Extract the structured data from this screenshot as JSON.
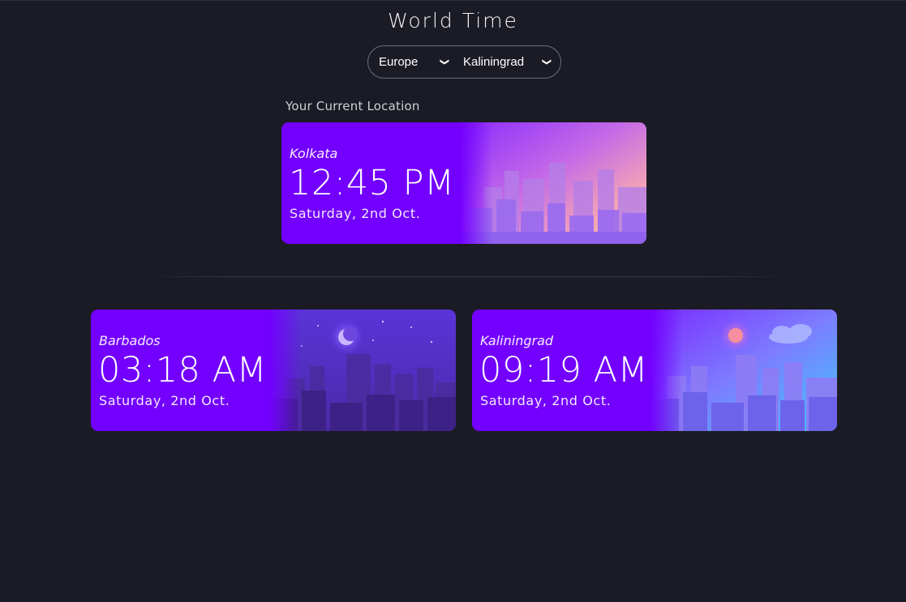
{
  "app": {
    "title": "World Time"
  },
  "selector": {
    "region": "Europe",
    "city": "Kaliningrad"
  },
  "current": {
    "label": "Your Current Location",
    "city": "Kolkata",
    "time": "12:45 PM",
    "date": "Saturday, 2nd Oct."
  },
  "clocks": [
    {
      "city": "Barbados",
      "time": "03:18 AM",
      "date": "Saturday, 2nd Oct."
    },
    {
      "city": "Kaliningrad",
      "time": "09:19 AM",
      "date": "Saturday, 2nd Oct."
    }
  ],
  "colors": {
    "background": "#1b1b25",
    "card": "#7300ff",
    "border": "#6e6e7a"
  }
}
